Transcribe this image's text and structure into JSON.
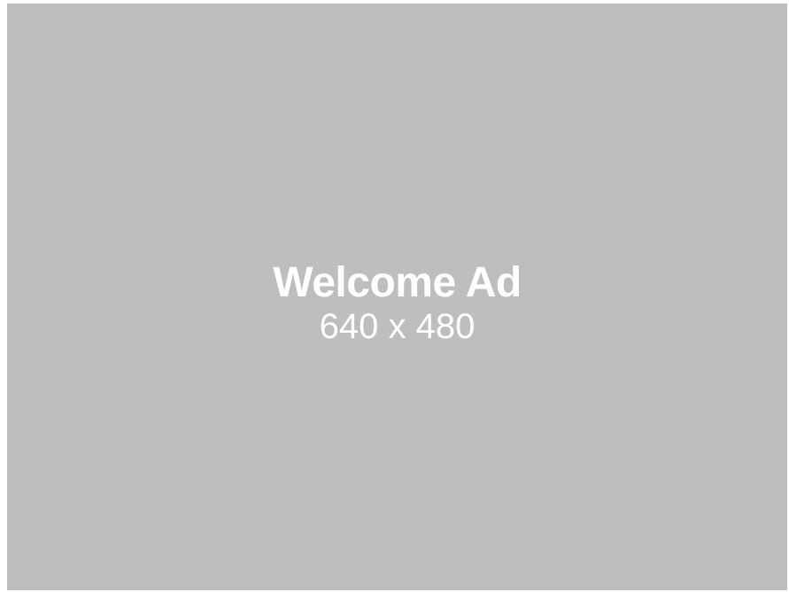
{
  "ad": {
    "title": "Welcome Ad",
    "size_label": "640 x 480",
    "background_color": "#bdbec0",
    "text_color": "#ffffff"
  }
}
